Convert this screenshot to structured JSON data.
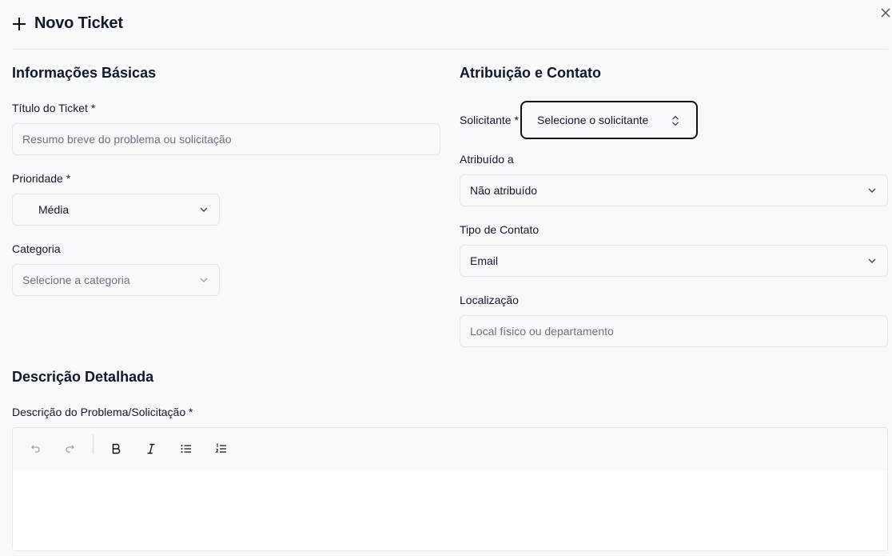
{
  "header": {
    "title": "Novo Ticket"
  },
  "basic": {
    "section_title": "Informações Básicas",
    "title_label": "Título do Ticket *",
    "title_placeholder": "Resumo breve do problema ou solicitação",
    "priority_label": "Prioridade *",
    "priority_value": "Média",
    "category_label": "Categoria",
    "category_placeholder": "Selecione a categoria"
  },
  "assignment": {
    "section_title": "Atribuição e Contato",
    "requester_label": "Solicitante *",
    "requester_placeholder": "Selecione o solicitante",
    "assigned_label": "Atribuído a",
    "assigned_value": "Não atribuído",
    "contact_type_label": "Tipo de Contato",
    "contact_type_value": "Email",
    "location_label": "Localização",
    "location_placeholder": "Local físico ou departamento"
  },
  "description": {
    "section_title": "Descrição Detalhada",
    "field_label": "Descrição do Problema/Solicitação *",
    "toolbar_icons": [
      "undo-icon",
      "redo-icon",
      "bold-icon",
      "italic-icon",
      "bullet-list-icon",
      "ordered-list-icon"
    ]
  }
}
